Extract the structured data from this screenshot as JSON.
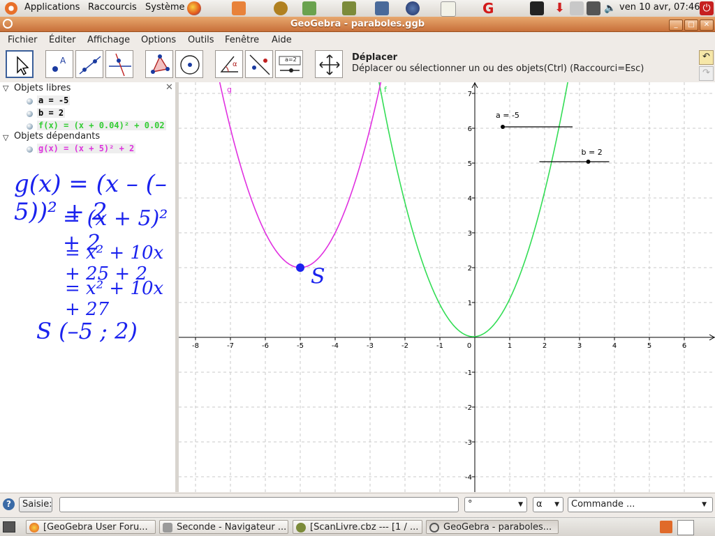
{
  "top_panel": {
    "menus": [
      "Applications",
      "Raccourcis",
      "Système"
    ],
    "clock": "ven 10 avr, 07:46"
  },
  "window": {
    "title": "GeoGebra - paraboles.ggb"
  },
  "menubar": [
    "Fichier",
    "Éditer",
    "Affichage",
    "Options",
    "Outils",
    "Fenêtre",
    "Aide"
  ],
  "toolbar": {
    "tool_title": "Déplacer",
    "tool_description": "Déplacer ou sélectionner un ou des objets(Ctrl) (Raccourci=Esc)",
    "slider_tool_label": "a=2"
  },
  "algebra": {
    "free_header": "Objets libres",
    "free_items": [
      {
        "text": "a = -5",
        "color": "#000000"
      },
      {
        "text": "b = 2",
        "color": "#000000"
      },
      {
        "text": "f(x) = (x + 0.04)² + 0.02",
        "color": "#33cc33"
      }
    ],
    "dep_header": "Objets dépendants",
    "dep_items": [
      {
        "text": "g(x) = (x + 5)² + 2",
        "color": "#dd33dd"
      }
    ],
    "handwriting": {
      "line1": "g(x) = (x – (–5))² + 2",
      "line2": "= (x + 5)² + 2",
      "line3": "= x² + 10x + 25 + 2",
      "line4": "= x² + 10x + 27",
      "line5": "S (–5 ; 2)",
      "color": "#1a22ee"
    }
  },
  "graphics": {
    "x_ticks": [
      "-8",
      "-7",
      "-6",
      "-5",
      "-4",
      "-3",
      "-2",
      "-1",
      "0",
      "1",
      "2",
      "3",
      "4",
      "5",
      "6"
    ],
    "y_ticks": [
      "7",
      "6",
      "5",
      "4",
      "3",
      "2",
      "1",
      "0",
      "-1",
      "-2",
      "-3",
      "-4"
    ],
    "curve_g_label": "g",
    "curve_f_label": "f",
    "slider_a_label": "a = -5",
    "slider_b_label": "b = 2",
    "point_label": "S",
    "colors": {
      "f": "#33dd55",
      "g": "#e030e0",
      "point": "#1a22ee"
    }
  },
  "inputbar": {
    "label": "Saisie:",
    "degree_value": "°",
    "alpha_value": "α",
    "command_placeholder": "Commande ..."
  },
  "taskbar": [
    "[GeoGebra User Foru...",
    "Seconde - Navigateur ...",
    "[ScanLivre.cbz --- [1 / ...",
    "GeoGebra - paraboles..."
  ]
}
